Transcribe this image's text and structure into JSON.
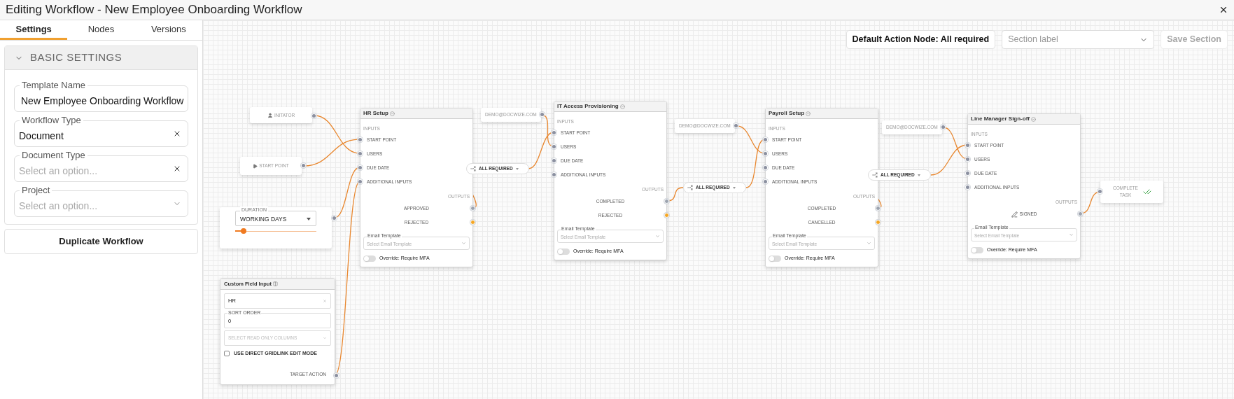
{
  "window": {
    "title": "Editing Workflow - New Employee Onboarding Workflow"
  },
  "sidebar": {
    "tabs": [
      {
        "label": "Settings",
        "selected": true
      },
      {
        "label": "Nodes",
        "selected": false
      },
      {
        "label": "Versions",
        "selected": false
      }
    ],
    "section": {
      "title": "BASIC SETTINGS",
      "expanded": true
    },
    "fields": [
      {
        "label": "Template Name",
        "value": "New Employee Onboarding Workflow",
        "kind": "text"
      },
      {
        "label": "Workflow Type",
        "value": "Document",
        "kind": "clearable"
      },
      {
        "label": "Document Type",
        "placeholder": "Select an option...",
        "kind": "clearable"
      },
      {
        "label": "Project",
        "placeholder": "Select an option...",
        "kind": "select"
      }
    ],
    "button": "Duplicate Workflow"
  },
  "toolbar": {
    "default_action": "Default Action Node: All required",
    "section_select": {
      "placeholder": "Section label"
    },
    "save_button": {
      "label": "Save Section",
      "disabled": true
    }
  },
  "canvas": {
    "sources": [
      {
        "kind": "initiator",
        "label": "INITATOR"
      },
      {
        "kind": "start",
        "label": "START POINT"
      }
    ],
    "duration": {
      "label": "DURATION",
      "value": "WORKING DAYS",
      "level": 0.1
    },
    "custom_field": {
      "title": "Custom Field Input",
      "value": "HR",
      "sort_label": "SORT ORDER",
      "sort_value": "0",
      "columns_placeholder": "SELECT READ ONLY COLUMNS",
      "checkbox": {
        "label": "USE DIRECT GRIDLINK EDIT MODE",
        "checked": false
      },
      "output": "TARGET ACTION"
    },
    "steps": [
      {
        "title": "HR Setup",
        "inputs_label": "INPUTS",
        "inputs": [
          "START POINT",
          "USERS",
          "DUE DATE",
          "ADDITIONAL INPUTS"
        ],
        "outputs_label": "OUTPUTS",
        "outputs": [
          {
            "label": "APPROVED",
            "kind": "text",
            "color": "#9ca3af"
          },
          {
            "label": "REJECTED",
            "kind": "text",
            "color": "#f5a623"
          }
        ],
        "email_label": "Email Template",
        "email_placeholder": "Select Email Template",
        "mfa": {
          "label": "Override: Require MFA",
          "on": false
        }
      },
      {
        "title": "IT Access Provisioning",
        "inputs_label": "INPUTS",
        "inputs": [
          "START POINT",
          "USERS",
          "DUE DATE",
          "ADDITIONAL INPUTS"
        ],
        "outputs_label": "OUTPUTS",
        "outputs": [
          {
            "label": "COMPLETED",
            "kind": "text",
            "color": "#9ca3af"
          },
          {
            "label": "REJECTED",
            "kind": "text",
            "color": "#f5a623"
          }
        ],
        "email_label": "Email Template",
        "email_placeholder": "Select Email Template",
        "mfa": {
          "label": "Override: Require MFA",
          "on": false
        }
      },
      {
        "title": "Payroll Setup",
        "inputs_label": "INPUTS",
        "inputs": [
          "START POINT",
          "USERS",
          "DUE DATE",
          "ADDITIONAL INPUTS"
        ],
        "outputs_label": "OUTPUTS",
        "outputs": [
          {
            "label": "COMPLETED",
            "kind": "text",
            "color": "#9ca3af"
          },
          {
            "label": "CANCELLED",
            "kind": "text",
            "color": "#f5a623"
          }
        ],
        "email_label": "Email Template",
        "email_placeholder": "Select Email Template",
        "mfa": {
          "label": "Override: Require MFA",
          "on": false
        }
      },
      {
        "title": "Line Manager Sign-off",
        "inputs_label": "INPUTS",
        "inputs": [
          "START POINT",
          "USERS",
          "DUE DATE",
          "ADDITIONAL INPUTS"
        ],
        "outputs_label": "OUTPUTS",
        "outputs": [
          {
            "label": "SIGNED",
            "kind": "signature",
            "color": "#9ca3af"
          }
        ],
        "email_label": "Email Template",
        "email_placeholder": "Select Email Template",
        "mfa": {
          "label": "Override: Require MFA",
          "on": false
        }
      }
    ],
    "emails": [
      "DEMO@DOCWIZE.COM",
      "DEMO@DOCWIZE.COM",
      "DEMO@DOCWIZE.COM"
    ],
    "gates": [
      "ALL REQUIRED",
      "ALL REQUIRED",
      "ALL REQUIRED"
    ],
    "end": {
      "label": "COMPLETE TASK"
    }
  }
}
